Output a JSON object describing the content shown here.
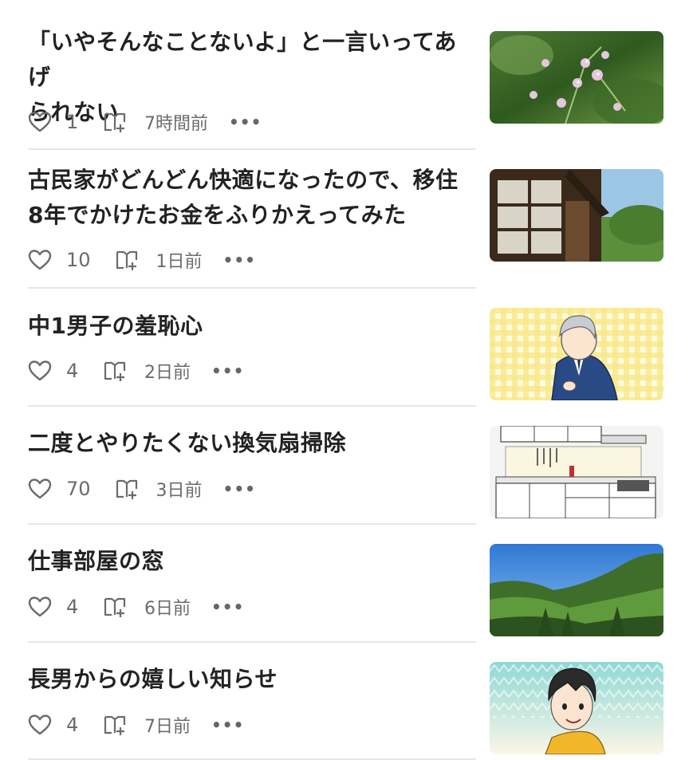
{
  "articles": [
    {
      "title_lines": [
        "「いやそんなことないよ」と一言いってあげ",
        "られない"
      ],
      "likes": "1",
      "time": "7時間前",
      "thumb": "flowers"
    },
    {
      "title_lines": [
        "古民家がどんどん快適になったので、移住",
        "8年でかけたお金をふりかえってみた"
      ],
      "likes": "10",
      "time": "1日前",
      "thumb": "house"
    },
    {
      "title_lines": [
        "中1男子の羞恥心"
      ],
      "likes": "4",
      "time": "2日前",
      "thumb": "illustration-boy-suit"
    },
    {
      "title_lines": [
        "二度とやりたくない換気扇掃除"
      ],
      "likes": "70",
      "time": "3日前",
      "thumb": "kitchen"
    },
    {
      "title_lines": [
        "仕事部屋の窓"
      ],
      "likes": "4",
      "time": "6日前",
      "thumb": "mountains"
    },
    {
      "title_lines": [
        "長男からの嬉しい知らせ"
      ],
      "likes": "4",
      "time": "7日前",
      "thumb": "illustration-boy-smile"
    }
  ],
  "more_label": "•••",
  "colors": {
    "text": "#222222",
    "meta": "#6b6b6b",
    "divider": "#e6e6e6"
  }
}
